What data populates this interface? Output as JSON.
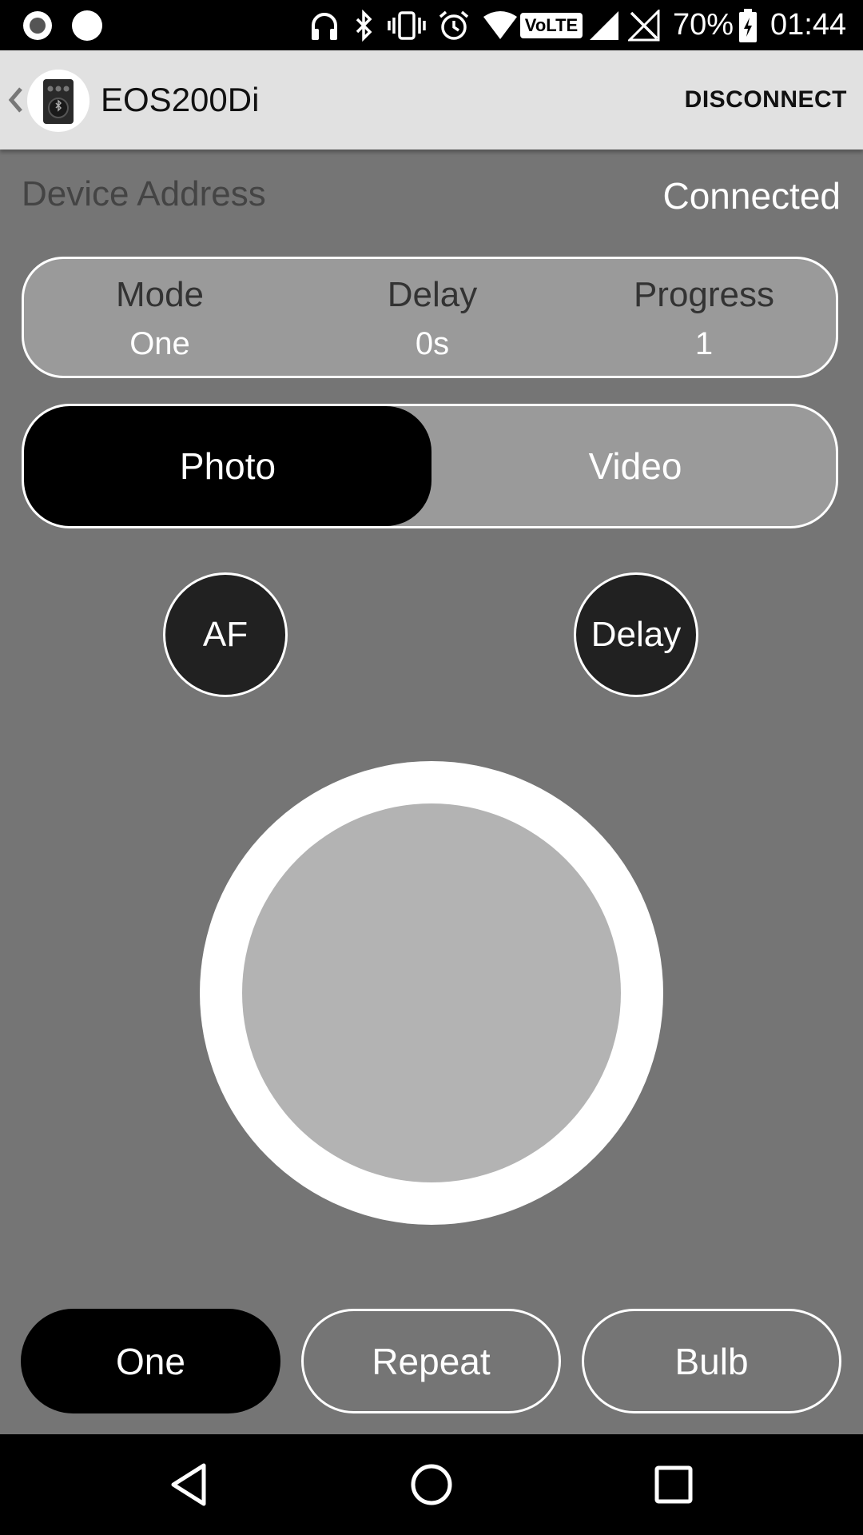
{
  "status_bar": {
    "battery": "70%",
    "time": "01:44",
    "volte": "VoLTE"
  },
  "app_bar": {
    "title": "EOS200Di",
    "action": "DISCONNECT"
  },
  "device": {
    "address_label": "Device Address",
    "status": "Connected"
  },
  "info": [
    {
      "label": "Mode",
      "value": "One"
    },
    {
      "label": "Delay",
      "value": "0s"
    },
    {
      "label": "Progress",
      "value": "1"
    }
  ],
  "capture_type": {
    "options": [
      "Photo",
      "Video"
    ],
    "selected": "Photo"
  },
  "controls": {
    "af": "AF",
    "delay": "Delay"
  },
  "modes": {
    "options": [
      "One",
      "Repeat",
      "Bulb"
    ],
    "selected": "One"
  },
  "colors": {
    "background": "#757575",
    "app_bar": "#e1e1e1",
    "active": "#000000",
    "shutter_inner": "#b3b3b3"
  }
}
